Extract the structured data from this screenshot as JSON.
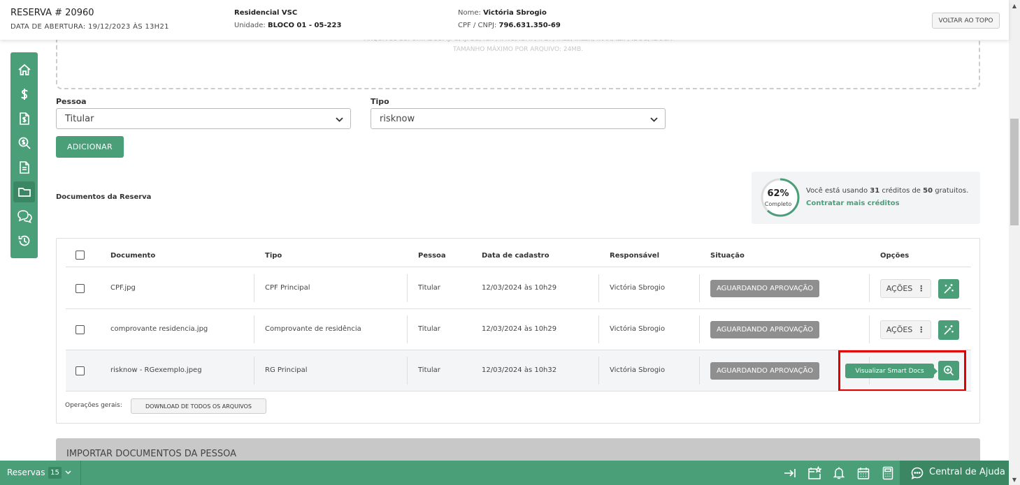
{
  "header": {
    "reserva_title": "RESERVA # 20960",
    "abertura": "DATA DE ABERTURA: 19/12/2023 ÀS 13H21",
    "empreendimento": "Residencial VSC",
    "unidade_label": "Unidade:",
    "unidade_value": "BLOCO 01 - 05-223",
    "nome_label": "Nome:",
    "nome_value": "Victória Sbrogio",
    "cpf_label": "CPF / CNPJ:",
    "cpf_value": "796.631.350-69",
    "voltar_topo": "VOLTAR AO TOPO"
  },
  "upload": {
    "formats": "ARQUIVOS SUPORTADOS: .JPG, .JPEG, .GIF, .PNG, .BMP, .PDF, .XLS, .XLSX, .RAR, .ZIP, .DOC, .DOCX",
    "max_size": "TAMANHO MÁXIMO POR ARQUIVO: 24MB."
  },
  "form": {
    "pessoa_label": "Pessoa",
    "pessoa_value": "Titular",
    "tipo_label": "Tipo",
    "tipo_value": "risknow",
    "adicionar": "ADICIONAR"
  },
  "documents_title": "Documentos da Reserva",
  "credits": {
    "percent_text": "62%",
    "percent": 62,
    "completo": "Completo",
    "text_pre": "Você está usando ",
    "used": "31",
    "text_mid": " créditos de ",
    "total": "50",
    "text_post": " gratuitos.",
    "link": "Contratar mais créditos"
  },
  "table": {
    "headers": {
      "documento": "Documento",
      "tipo": "Tipo",
      "pessoa": "Pessoa",
      "data": "Data de cadastro",
      "responsavel": "Responsável",
      "situacao": "Situação",
      "opcoes": "Opções"
    },
    "rows": [
      {
        "documento": "CPF.jpg",
        "tipo": "CPF Principal",
        "pessoa": "Titular",
        "data": "12/03/2024 às 10h29",
        "responsavel": "Victória Sbrogio",
        "situacao": "AGUARDANDO APROVAÇÃO",
        "acoes": "AÇÕES"
      },
      {
        "documento": "comprovante residencia.jpg",
        "tipo": "Comprovante de residência",
        "pessoa": "Titular",
        "data": "12/03/2024 às 10h29",
        "responsavel": "Victória Sbrogio",
        "situacao": "AGUARDANDO APROVAÇÃO",
        "acoes": "AÇÕES"
      },
      {
        "documento": "risknow - RGexemplo.jpeg",
        "tipo": "RG Principal",
        "pessoa": "Titular",
        "data": "12/03/2024 às 10h32",
        "responsavel": "Victória Sbrogio",
        "situacao": "AGUARDANDO APROVAÇÃO",
        "tooltip": "Visualizar Smart Docs"
      }
    ],
    "operacoes_label": "Operações gerais:",
    "download_all": "DOWNLOAD DE TODOS OS ARQUIVOS"
  },
  "import_section": "IMPORTAR DOCUMENTOS DA PESSOA",
  "footer": {
    "reservas": "Reservas",
    "count": "15",
    "help": "Central de Ajuda"
  },
  "colors": {
    "brand": "#4a9e78",
    "brand_dark": "#3b8763",
    "badge": "#8f8f8f",
    "highlight": "#e00000"
  }
}
